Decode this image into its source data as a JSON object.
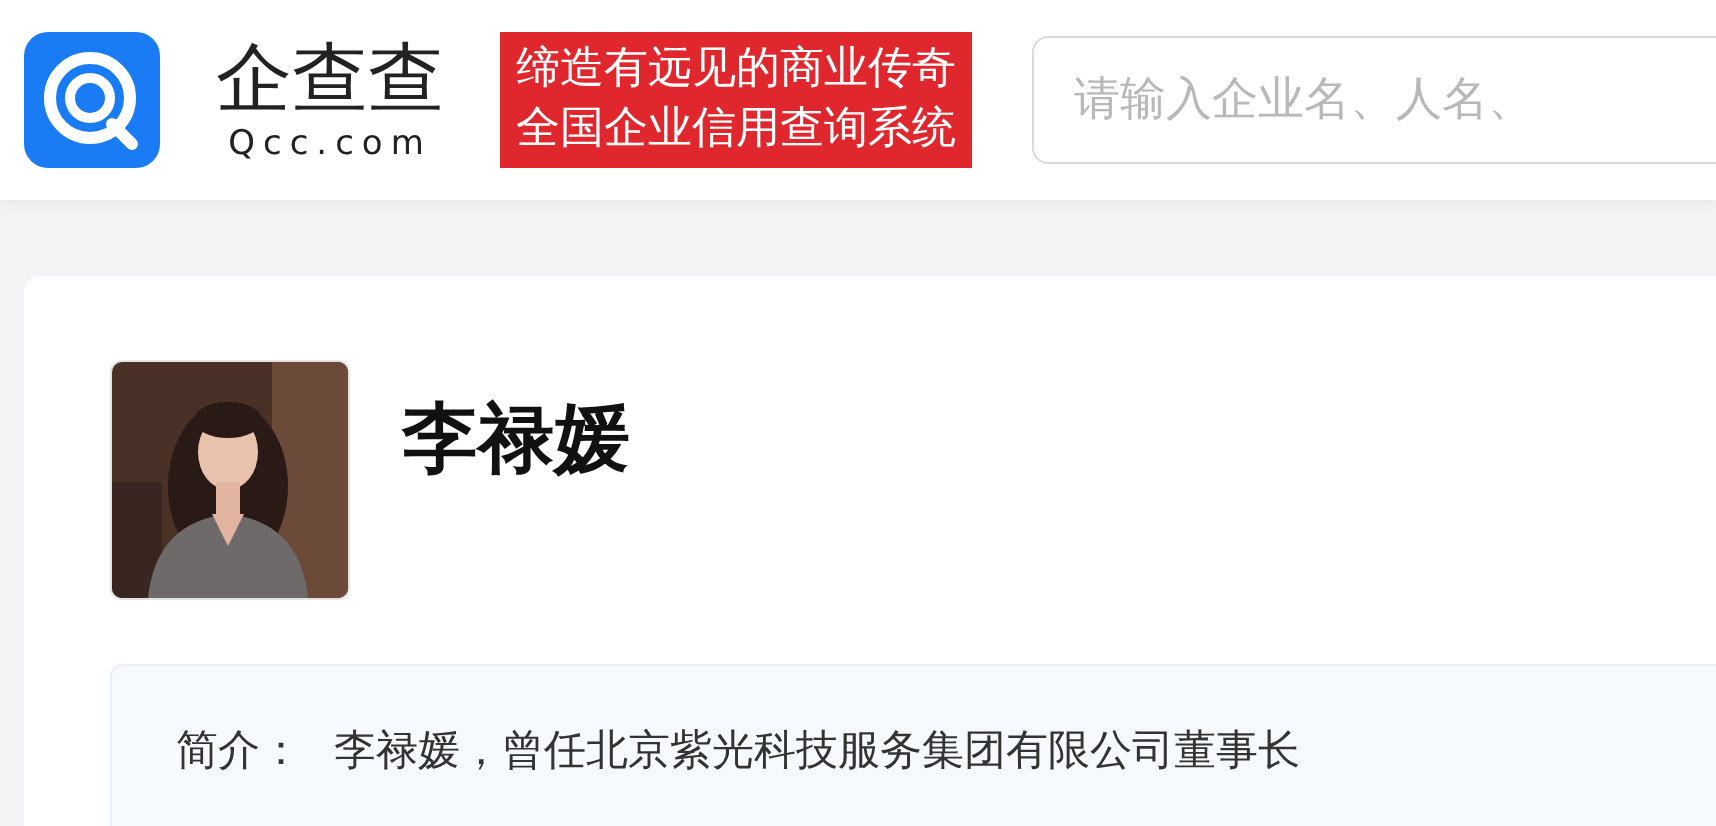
{
  "header": {
    "logo": {
      "name": "企查查",
      "domain": "Qcc.com"
    },
    "slogan": [
      "缔造有远见的商业传奇",
      "全国企业信用查询系统"
    ],
    "search": {
      "placeholder": "请输入企业名、人名、"
    }
  },
  "profile": {
    "name": "李禄媛",
    "intro": {
      "label": "简介：",
      "text": "李禄媛，曾任北京紫光科技服务集团有限公司董事长"
    }
  }
}
